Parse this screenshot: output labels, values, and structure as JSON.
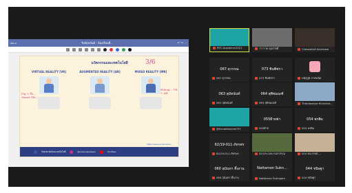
{
  "meeting": {
    "share": {
      "app_title": "วิทย์สุขสันต์ - ห้องเรียนที่...",
      "page_title": "นวัตกรรมและเทคโนโลยี",
      "columns": [
        {
          "title": "VIRTUAL REALITY [VR]"
        },
        {
          "title": "AUGMENTED REALITY [AR]"
        },
        {
          "title": "MIXED REALITY [MR]"
        }
      ],
      "notes": {
        "top_right": "3/6",
        "left": "Pig + สิ่ง... Smart Gla...",
        "right": "Hologr... VR + AR",
        "mid": "..."
      },
      "footer": [
        "วิทยาศาสตร์และเทคโนโลยี",
        "@sciencesukesun",
        "YouTube"
      ],
      "link": "https://www.sciencesuk...",
      "colors": {
        "bar": "#5b6fae",
        "page": "#fdf3dd",
        "footer": "#2d3f82",
        "ink": "#d23a8a"
      },
      "tool_colors": [
        "#222222",
        "#e0333a",
        "#3a6ad6",
        "#2da44e",
        "#111111"
      ]
    },
    "participants": [
      {
        "name": "ฺRTC.Academic2021",
        "type": "logo",
        "bg": "#1ea3a6",
        "active": true
      },
      {
        "name": "วาววาด ดุลสวัสดิ์",
        "type": "photo",
        "bg": "#6c6c6c"
      },
      {
        "name": "Chawphisit Kounkaw",
        "type": "photo",
        "bg": "#3b2f2a"
      },
      {
        "name": "067 ดุวรรณ",
        "type": "text",
        "label": "067 ดุวรรณ"
      },
      {
        "name": "073 ชินพิชรา",
        "type": "text",
        "label": "073 ชินพิชรา"
      },
      {
        "name": "พนิสุภูมิ ภาคพนิด",
        "type": "avatar",
        "bg": "#f7a7b6"
      },
      {
        "name": "063 สุมัทนันท์",
        "type": "text",
        "label": "063 สุมัทนันท์"
      },
      {
        "name": "064 สุพิชมณฑ์",
        "type": "text",
        "label": "064 สุพิชมณฑ์"
      },
      {
        "name": "Thanapanya Khinchai...",
        "type": "photo",
        "bg": "#8ea9c6"
      },
      {
        "name": "@tishaeteacherTH",
        "type": "logo",
        "bg": "#1ea3a6"
      },
      {
        "name": "055ฝ้าย",
        "type": "text",
        "label": "055ฝ้ายฟา"
      },
      {
        "name": "054 พรพิม",
        "type": "text",
        "label": "054 พรพิม"
      },
      {
        "name": "62/19-011-ภัทรพร",
        "type": "text",
        "label": "62/19-011-ภัทรพร"
      },
      {
        "name": "62/19-009-กนกวรรณ",
        "type": "photo",
        "bg": "#556b3e"
      },
      {
        "name": "004 ธนากรณ์ ...",
        "type": "photo",
        "bg": "#c4b196"
      },
      {
        "name": "060 สุนันทา ทิ้งงาน",
        "type": "text",
        "label": "060 สุนันทา ทิ้งงาน"
      },
      {
        "name": "Nattamon Sukngam",
        "type": "text",
        "label": "Nattamon Sukn..."
      },
      {
        "name": "044 ขนิษฐา",
        "type": "text",
        "label": "044 ขนิษฐา"
      }
    ]
  }
}
